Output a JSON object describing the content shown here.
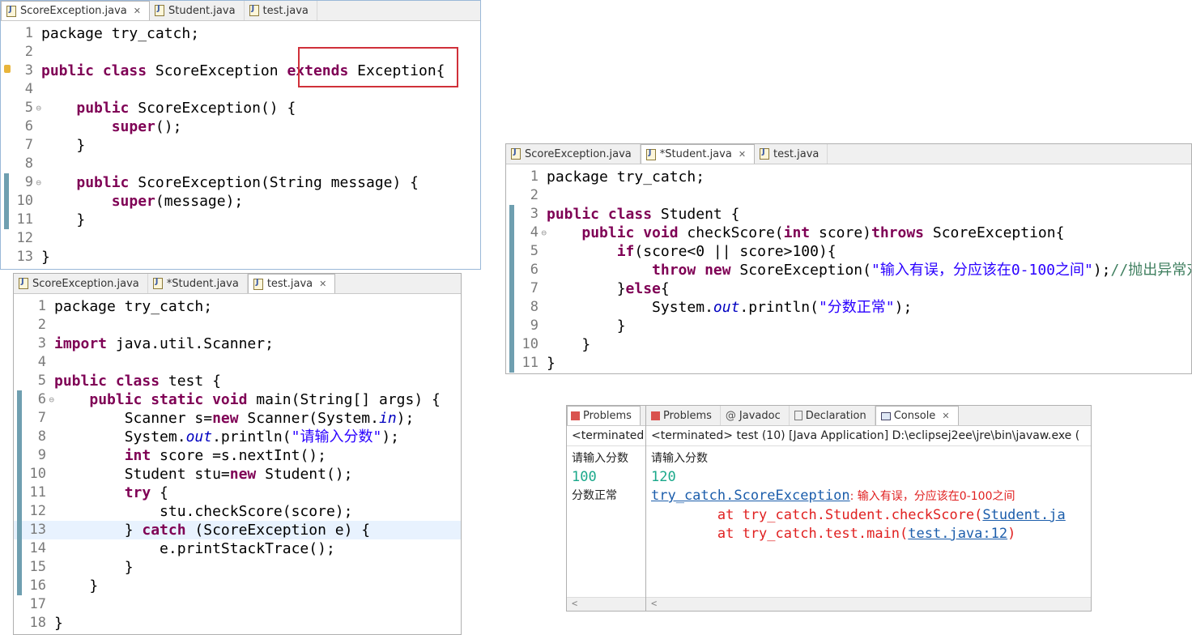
{
  "editor1": {
    "tabs": [
      {
        "label": "ScoreException.java",
        "close": "✕"
      },
      {
        "label": "Student.java"
      },
      {
        "label": "test.java"
      }
    ],
    "lines": [
      {
        "n": "1",
        "tokens": [
          {
            "t": "package try_catch;"
          }
        ]
      },
      {
        "n": "2",
        "tokens": [
          {
            "t": ""
          }
        ]
      },
      {
        "n": "3",
        "tokens": [
          {
            "c": "kw",
            "t": "public class"
          },
          {
            "t": " ScoreException "
          },
          {
            "c": "kw",
            "t": "extends"
          },
          {
            "t": " Exception{"
          }
        ]
      },
      {
        "n": "4",
        "tokens": [
          {
            "t": ""
          }
        ]
      },
      {
        "n": "5",
        "tokens": [
          {
            "t": "    "
          },
          {
            "c": "kw",
            "t": "public"
          },
          {
            "t": " ScoreException() {"
          }
        ]
      },
      {
        "n": "6",
        "tokens": [
          {
            "t": "        "
          },
          {
            "c": "kw",
            "t": "super"
          },
          {
            "t": "();"
          }
        ]
      },
      {
        "n": "7",
        "tokens": [
          {
            "t": "    }"
          }
        ]
      },
      {
        "n": "8",
        "tokens": [
          {
            "t": ""
          }
        ]
      },
      {
        "n": "9",
        "tokens": [
          {
            "t": "    "
          },
          {
            "c": "kw",
            "t": "public"
          },
          {
            "t": " ScoreException(String message) {"
          }
        ]
      },
      {
        "n": "10",
        "tokens": [
          {
            "t": "        "
          },
          {
            "c": "kw",
            "t": "super"
          },
          {
            "t": "(message);"
          }
        ]
      },
      {
        "n": "11",
        "tokens": [
          {
            "t": "    }"
          }
        ]
      },
      {
        "n": "12",
        "tokens": [
          {
            "t": ""
          }
        ]
      },
      {
        "n": "13",
        "tokens": [
          {
            "t": "}"
          }
        ]
      }
    ]
  },
  "editor2": {
    "tabs": [
      {
        "label": "ScoreException.java"
      },
      {
        "label": "*Student.java",
        "close": "✕"
      },
      {
        "label": "test.java"
      }
    ],
    "lines": [
      {
        "n": "1",
        "tokens": [
          {
            "t": "package try_catch;"
          }
        ]
      },
      {
        "n": "2",
        "tokens": [
          {
            "t": ""
          }
        ]
      },
      {
        "n": "3",
        "tokens": [
          {
            "c": "kw",
            "t": "public class"
          },
          {
            "t": " Student {"
          }
        ]
      },
      {
        "n": "4",
        "tokens": [
          {
            "t": "    "
          },
          {
            "c": "kw",
            "t": "public void"
          },
          {
            "t": " checkScore("
          },
          {
            "c": "kw",
            "t": "int"
          },
          {
            "t": " score)"
          },
          {
            "c": "kw",
            "t": "throws"
          },
          {
            "t": " ScoreException{"
          }
        ]
      },
      {
        "n": "5",
        "tokens": [
          {
            "t": "        "
          },
          {
            "c": "kw",
            "t": "if"
          },
          {
            "t": "(score<0 || score>100){"
          }
        ]
      },
      {
        "n": "6",
        "tokens": [
          {
            "t": "            "
          },
          {
            "c": "kw",
            "t": "throw new"
          },
          {
            "t": " ScoreException("
          },
          {
            "c": "str",
            "t": "\"输入有误，分应该在0-100之间\""
          },
          {
            "t": ");"
          },
          {
            "c": "cmt",
            "t": "//抛出异常对象"
          }
        ]
      },
      {
        "n": "7",
        "tokens": [
          {
            "t": "        }"
          },
          {
            "c": "kw",
            "t": "else"
          },
          {
            "t": "{"
          }
        ]
      },
      {
        "n": "8",
        "tokens": [
          {
            "t": "            System."
          },
          {
            "c": "it",
            "t": "out"
          },
          {
            "t": ".println("
          },
          {
            "c": "str",
            "t": "\"分数正常\""
          },
          {
            "t": ");"
          }
        ]
      },
      {
        "n": "9",
        "tokens": [
          {
            "t": "        }"
          }
        ]
      },
      {
        "n": "10",
        "tokens": [
          {
            "t": "    }"
          }
        ]
      },
      {
        "n": "11",
        "tokens": [
          {
            "t": "}"
          }
        ]
      }
    ]
  },
  "editor3": {
    "tabs": [
      {
        "label": "ScoreException.java"
      },
      {
        "label": "*Student.java"
      },
      {
        "label": "test.java",
        "close": "✕"
      }
    ],
    "lines": [
      {
        "n": "1",
        "tokens": [
          {
            "t": "package try_catch;"
          }
        ]
      },
      {
        "n": "2",
        "tokens": [
          {
            "t": ""
          }
        ]
      },
      {
        "n": "3",
        "tokens": [
          {
            "c": "kw",
            "t": "import"
          },
          {
            "t": " java.util.Scanner;"
          }
        ]
      },
      {
        "n": "4",
        "tokens": [
          {
            "t": ""
          }
        ]
      },
      {
        "n": "5",
        "tokens": [
          {
            "c": "kw",
            "t": "public class"
          },
          {
            "t": " test {"
          }
        ]
      },
      {
        "n": "6",
        "tokens": [
          {
            "t": "    "
          },
          {
            "c": "kw",
            "t": "public static void"
          },
          {
            "t": " main(String[] args) {"
          }
        ]
      },
      {
        "n": "7",
        "tokens": [
          {
            "t": "        Scanner s="
          },
          {
            "c": "kw",
            "t": "new"
          },
          {
            "t": " Scanner(System."
          },
          {
            "c": "it",
            "t": "in"
          },
          {
            "t": ");"
          }
        ]
      },
      {
        "n": "8",
        "tokens": [
          {
            "t": "        System."
          },
          {
            "c": "it",
            "t": "out"
          },
          {
            "t": ".println("
          },
          {
            "c": "str",
            "t": "\"请输入分数\""
          },
          {
            "t": ");"
          }
        ]
      },
      {
        "n": "9",
        "tokens": [
          {
            "t": "        "
          },
          {
            "c": "kw",
            "t": "int"
          },
          {
            "t": " score =s.nextInt();"
          }
        ]
      },
      {
        "n": "10",
        "tokens": [
          {
            "t": "        Student stu="
          },
          {
            "c": "kw",
            "t": "new"
          },
          {
            "t": " Student();"
          }
        ]
      },
      {
        "n": "11",
        "tokens": [
          {
            "t": "        "
          },
          {
            "c": "kw",
            "t": "try"
          },
          {
            "t": " {"
          }
        ]
      },
      {
        "n": "12",
        "tokens": [
          {
            "t": "            stu.checkScore(score);"
          }
        ]
      },
      {
        "n": "13",
        "tokens": [
          {
            "t": "        } "
          },
          {
            "c": "kw",
            "t": "catch"
          },
          {
            "t": " (ScoreException e) {"
          }
        ]
      },
      {
        "n": "14",
        "tokens": [
          {
            "t": "            e.printStackTrace();"
          }
        ]
      },
      {
        "n": "15",
        "tokens": [
          {
            "t": "        }"
          }
        ]
      },
      {
        "n": "16",
        "tokens": [
          {
            "t": "    }"
          }
        ]
      },
      {
        "n": "17",
        "tokens": [
          {
            "t": ""
          }
        ]
      },
      {
        "n": "18",
        "tokens": [
          {
            "t": "}"
          }
        ]
      }
    ]
  },
  "console_back": {
    "tab": "Problems",
    "header": "<terminated",
    "lines": [
      "请输入分数",
      "100",
      "分数正常"
    ]
  },
  "console_front": {
    "tabs": [
      "Problems",
      "Javadoc",
      "Declaration",
      "Console"
    ],
    "console_close": "✕",
    "header": "<terminated> test (10) [Java Application] D:\\eclipsej2ee\\jre\\bin\\javaw.exe (",
    "prompt": "请输入分数",
    "input": "120",
    "exception_class": "try_catch.ScoreException",
    "exception_msg": ": 输入有误，分应该在0-100之间",
    "trace1_prefix": "        at try_catch.Student.checkScore(",
    "trace1_link": "Student.ja",
    "trace2_prefix": "        at try_catch.test.main(",
    "trace2_link": "test.java:12",
    "trace2_suffix": ")",
    "scroll_left": "<"
  }
}
